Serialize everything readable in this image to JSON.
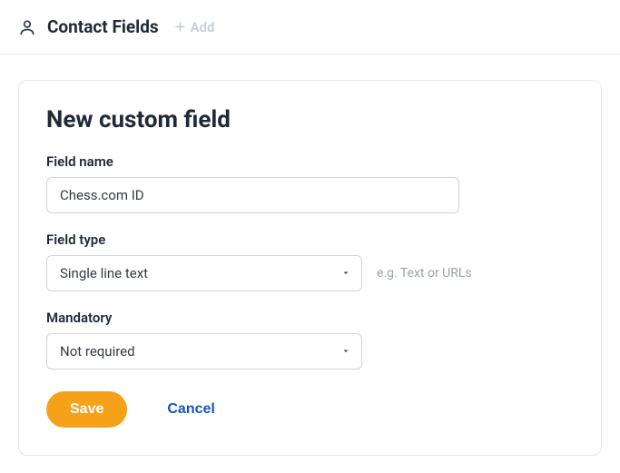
{
  "header": {
    "title": "Contact Fields",
    "add_label": "Add"
  },
  "form": {
    "title": "New custom field",
    "field_name": {
      "label": "Field name",
      "value": "Chess.com ID"
    },
    "field_type": {
      "label": "Field type",
      "value": "Single line text",
      "hint": "e.g. Text or URLs"
    },
    "mandatory": {
      "label": "Mandatory",
      "value": "Not required"
    },
    "actions": {
      "save": "Save",
      "cancel": "Cancel"
    }
  }
}
